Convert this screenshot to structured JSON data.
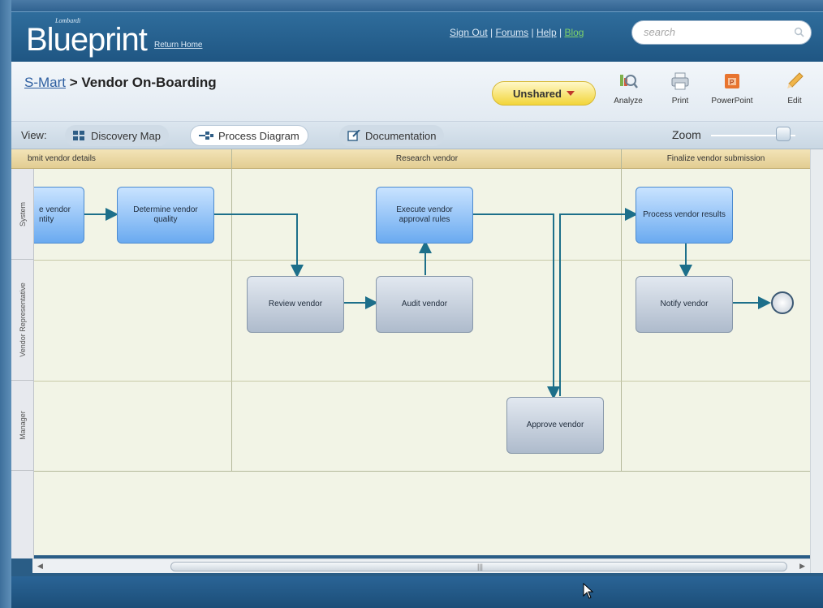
{
  "header": {
    "brand_small": "Lombardi",
    "brand": "Blueprint",
    "return_home": "Return Home",
    "links": [
      "Sign Out",
      "Forums",
      "Help",
      "Blog"
    ],
    "search_placeholder": "search"
  },
  "titlebar": {
    "crumb_link": "S-Mart",
    "crumb_sep": " > ",
    "page_title": "Vendor On-Boarding",
    "share_status": "Unshared",
    "tools": [
      "Analyze",
      "Print",
      "PowerPoint",
      "Edit"
    ]
  },
  "viewbar": {
    "label": "View:",
    "tabs": [
      "Discovery Map",
      "Process Diagram",
      "Documentation"
    ],
    "active_tab": "Process Diagram",
    "zoom_label": "Zoom"
  },
  "diagram": {
    "phases": [
      "bmit vendor details",
      "Research vendor",
      "Finalize vendor submission"
    ],
    "lanes": [
      "System",
      "Vendor Representative",
      "Manager"
    ],
    "tasks": {
      "create_vendor": "e vendor\nntity",
      "determine_quality": "Determine vendor quality",
      "execute_rules": "Execute vendor approval rules",
      "process_results": "Process vendor results",
      "review_vendor": "Review vendor",
      "audit_vendor": "Audit vendor",
      "notify_vendor": "Notify vendor",
      "approve_vendor": "Approve vendor"
    }
  },
  "colors": {
    "header": "#1f5683",
    "system_task": "#6aaaf0",
    "human_task": "#aebbcc",
    "connector": "#1d6f8a",
    "phase_header": "#e2cd92"
  }
}
